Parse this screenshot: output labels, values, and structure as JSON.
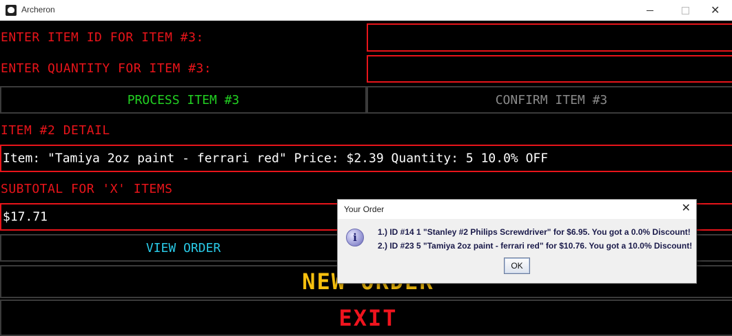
{
  "window": {
    "title": "Archeron"
  },
  "form": {
    "item_id_label": "ENTER ITEM ID FOR ITEM #3:",
    "item_id_value": "",
    "quantity_label": "ENTER QUANTITY FOR ITEM #3:",
    "quantity_value": "",
    "detail_label": "ITEM #2 DETAIL",
    "detail_value": "Item: \"Tamiya 2oz paint - ferrari red\"  Price: $2.39  Quantity: 5  10.0% OFF",
    "subtotal_label": "SUBTOTAL FOR 'X' ITEMS",
    "subtotal_value": "$17.71"
  },
  "buttons": {
    "process": "PROCESS ITEM #3",
    "confirm": "CONFIRM ITEM #3",
    "view_order": "VIEW ORDER",
    "new_order": "NEW ORDER",
    "exit": "EXIT"
  },
  "dialog": {
    "title": "Your Order",
    "close_glyph": "✕",
    "icon_glyph": "i",
    "lines": [
      "1.) ID #14 1 \"Stanley #2 Philips Screwdriver\" for  $6.95. You got a 0.0% Discount!",
      "2.) ID #23 5 \"Tamiya 2oz paint - ferrari red\" for  $10.76. You got a 10.0% Discount!"
    ],
    "ok_label": "OK"
  },
  "colors": {
    "label_red": "#e8141a",
    "process_green": "#22d022",
    "confirm_gray": "#8a8a8a",
    "view_cyan": "#29c9e6",
    "new_order_yellow": "#f7c00e",
    "exit_red": "#f0141e"
  }
}
